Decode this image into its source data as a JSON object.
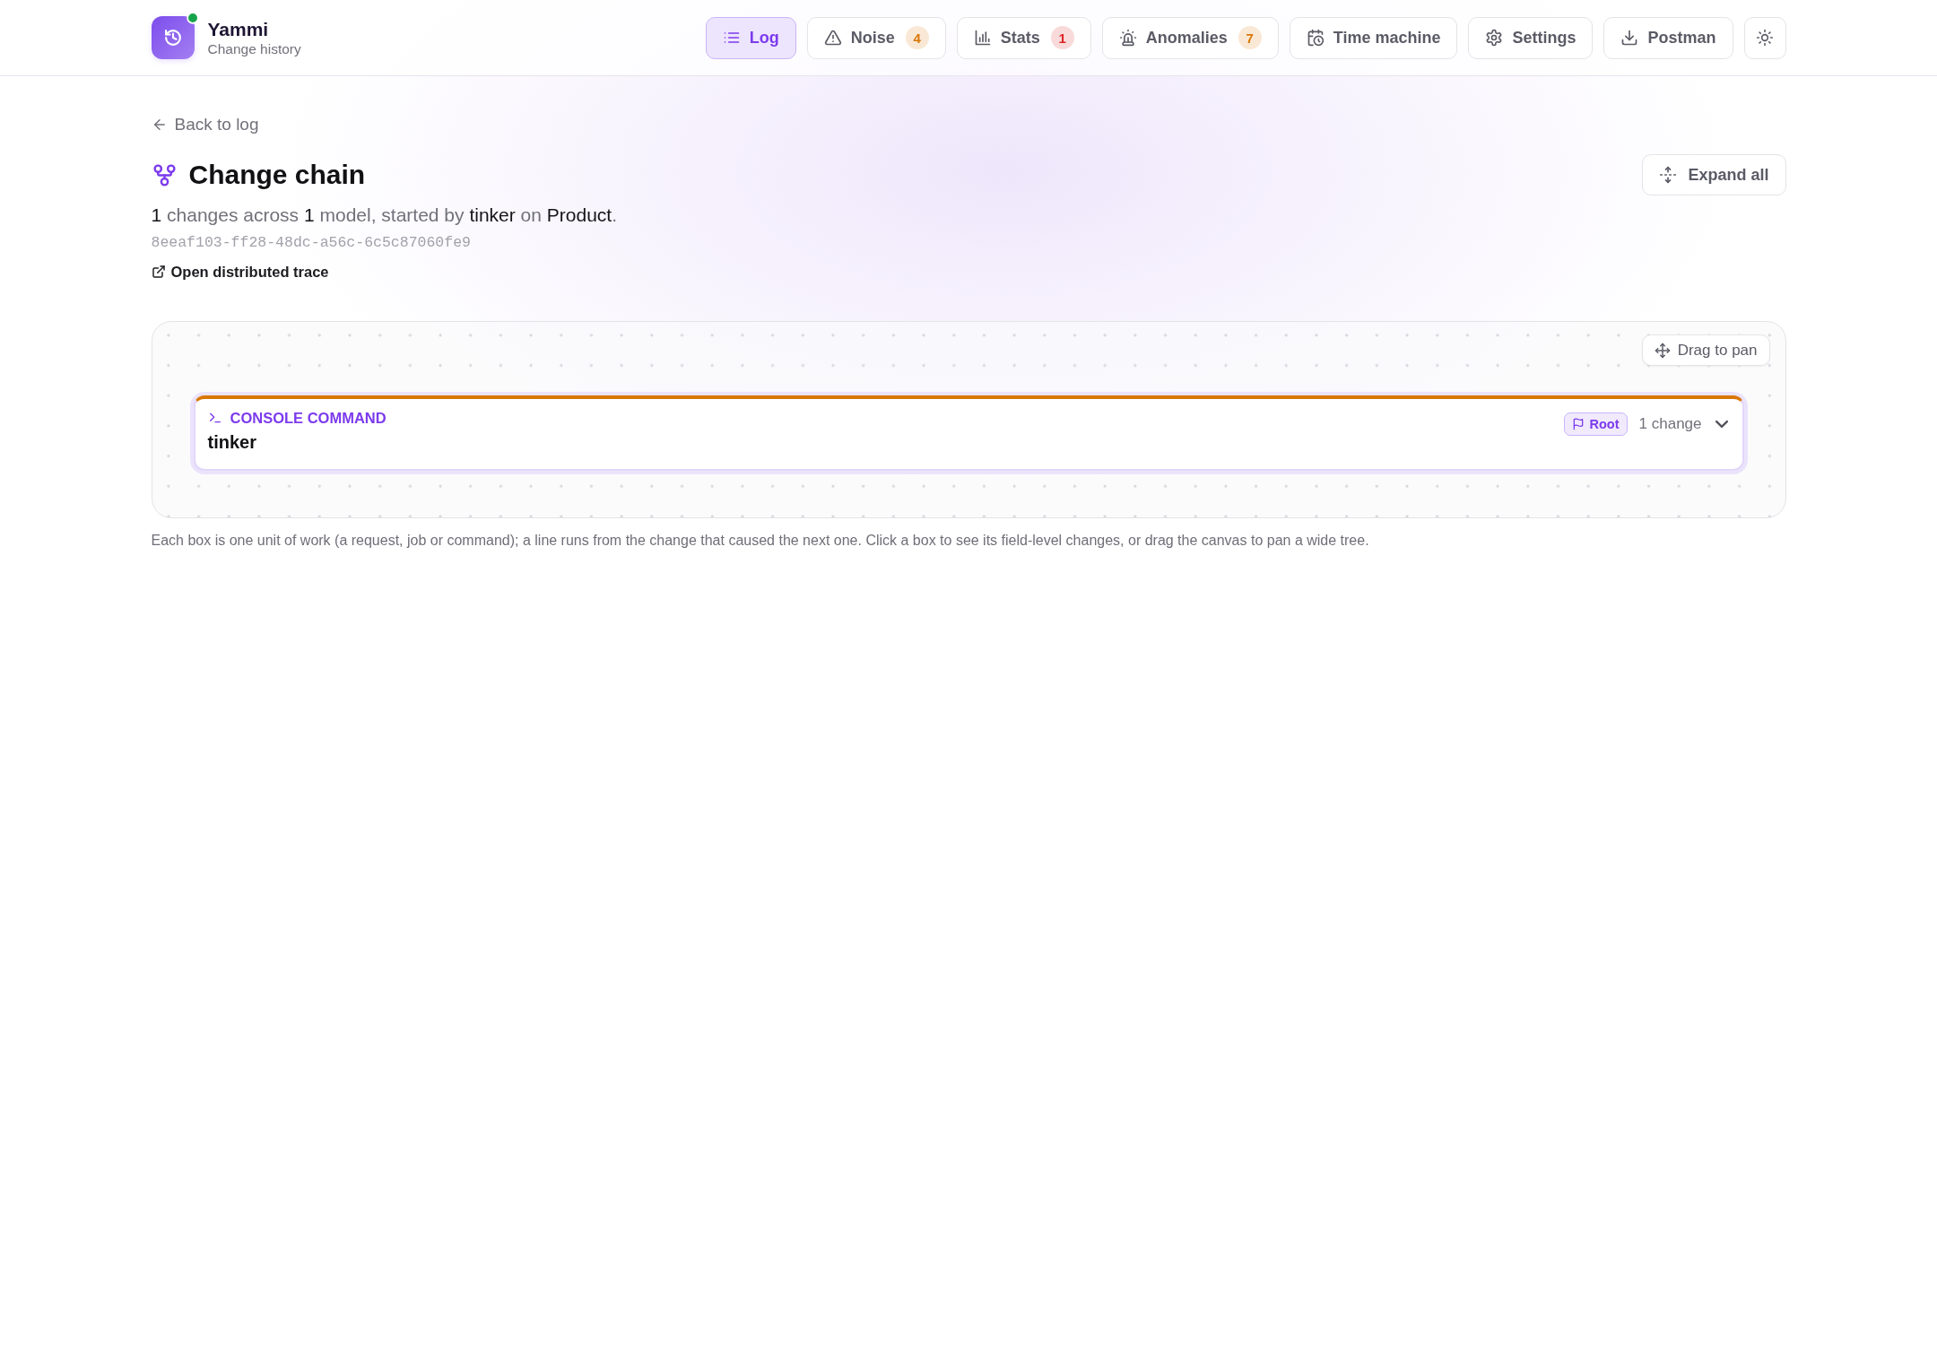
{
  "app": {
    "name": "Yammi",
    "subtitle": "Change history",
    "live": true
  },
  "nav": [
    {
      "label": "Log",
      "selected": true
    },
    {
      "label": "Noise",
      "selected": false,
      "badge": {
        "text": "4",
        "color": "#d97706"
      }
    },
    {
      "label": "Stats",
      "selected": false,
      "badge": {
        "text": "1",
        "color": "#dc2626"
      }
    },
    {
      "label": "Anomalies",
      "selected": false,
      "badge": {
        "text": "7",
        "color": "#d97706"
      }
    },
    {
      "label": "Time machine",
      "selected": false
    },
    {
      "label": "Settings",
      "selected": false
    },
    {
      "label": "Postman",
      "selected": false
    }
  ],
  "page": {
    "back_link": "Back to log",
    "title": "Change chain",
    "expand_button": "Expand all",
    "summary": "**1** changes across **1** model, started by **tinker** on **Product**.",
    "trace_id": "8eeaf103-ff28-48dc-a56c-6c5c87060fe9",
    "trace_link": "Open distributed trace"
  },
  "canvas": {
    "pan_hint": "Drag to pan",
    "nodes": [
      {
        "type_label": "CONSOLE COMMAND",
        "title": "tinker",
        "color": "#d97706",
        "selected": true,
        "badge": "Root",
        "change_count": "1 change",
        "expanded": false
      }
    ]
  },
  "help_text": "Each box is one unit of work (a request, job or command); a line runs from the change that caused the next one. Click a box to see its field-level changes, or drag the canvas to pan a wide tree."
}
